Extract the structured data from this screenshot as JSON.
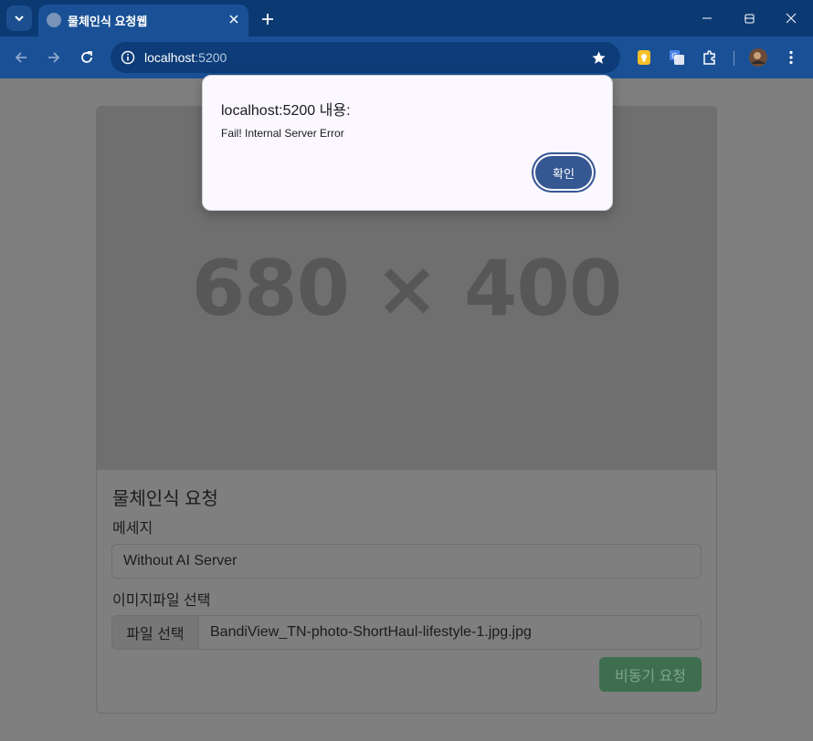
{
  "browser": {
    "tab_title": "물체인식 요청웹",
    "url_host": "localhost",
    "url_port": ":5200"
  },
  "page": {
    "image_placeholder": "680 × 400",
    "card_title": "물체인식 요청",
    "message_label": "메세지",
    "message_value": "Without AI Server",
    "file_label": "이미지파일 선택",
    "file_button": "파일 선택",
    "file_name": "BandiView_TN-photo-ShortHaul-lifestyle-1.jpg.jpg",
    "submit_button": "비동기 요청"
  },
  "dialog": {
    "title": "localhost:5200 내용:",
    "message": "Fail! Internal Server Error",
    "ok_button": "확인"
  },
  "colors": {
    "titlebar": "#0b3a73",
    "toolbar": "#1a5196",
    "submit": "#3e6e4f",
    "dialog_button": "#355792"
  }
}
